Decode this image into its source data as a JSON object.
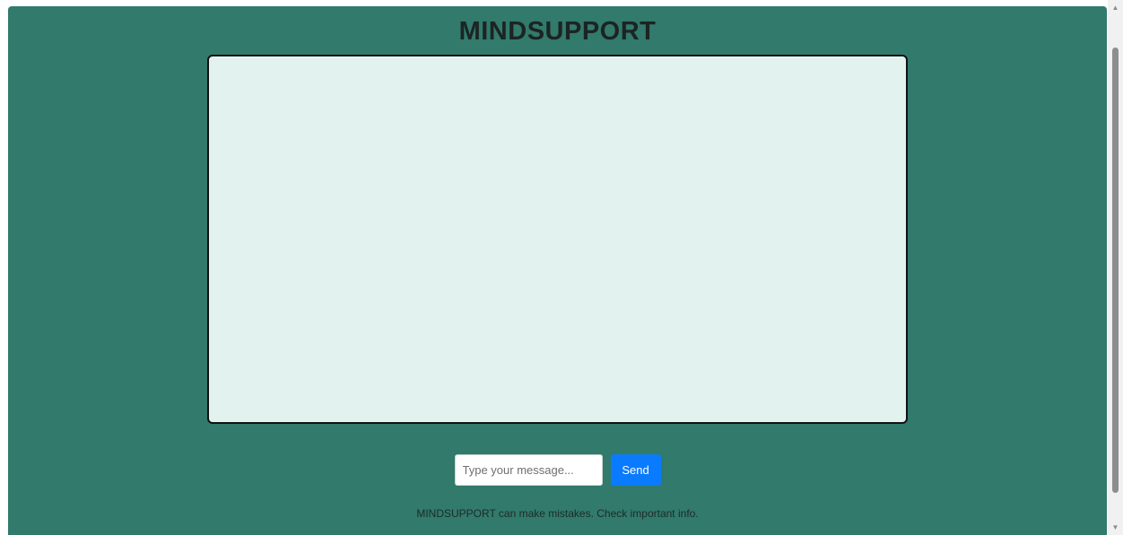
{
  "app": {
    "title": "MINDSUPPORT"
  },
  "chat": {
    "messages": []
  },
  "composer": {
    "placeholder": "Type your message...",
    "value": "",
    "send_label": "Send"
  },
  "footer": {
    "disclaimer": "MINDSUPPORT can make mistakes. Check important info."
  },
  "scrollbar": {
    "up_icon": "▲",
    "down_icon": "▼"
  },
  "colors": {
    "page_background": "#317a6c",
    "chat_background": "#e2f3ef",
    "send_button": "#0a7bff",
    "title_text": "#1c2423"
  }
}
